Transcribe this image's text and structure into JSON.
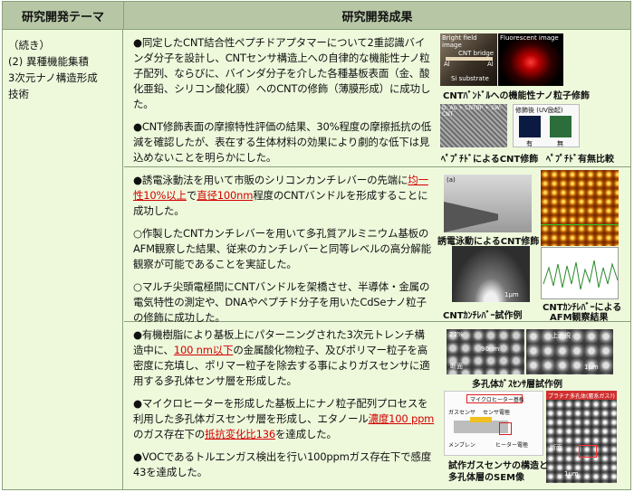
{
  "headers": {
    "left": "研究開発テーマ",
    "right": "研究開発成果"
  },
  "theme": {
    "line1": "（続き）",
    "line2": "(2) 異種機能集積",
    "line3": "3次元ナノ構造形成",
    "line4": "技術"
  },
  "section1": {
    "p1": "●同定したCNT結合性ペプチドアプタマーについて2重認識バインダ分子を設計し、CNTセンサ構造上への自律的な機能性ナノ粒子配列、ならびに、バインダ分子を介した各種基板表面（金、酸化亜鉛、シリコン酸化膜）へのCNTの修飾（薄膜形成）に成功した。",
    "p2": "●CNT修飾表面の摩擦特性評価の結果、30%程度の摩擦抵抗の低減を確認したが、表在する生体材料の効果により劇的な低下は見込めないことを明らかにした。",
    "img_bright": "Bright field image",
    "img_fluor": "Fluorescent image",
    "img_cnt_bridge": "CNT bridge",
    "img_al": "Al",
    "img_si": "Si substrate",
    "img_sem_label": "D: Au + CNTBP + SW-CNT",
    "img_mod_label": "修飾後 (UV励起)",
    "img_yes": "有",
    "img_no": "無",
    "cap1": "CNTﾊﾞﾝﾄﾞﾙへの機能性ナノ粒子修飾",
    "cap2": "ﾍﾟﾌﾟﾁﾄﾞによるCNT修飾",
    "cap3": "ﾍﾟﾌﾟﾁﾄﾞ有無比較"
  },
  "section2": {
    "p1a": "●誘電泳動法を用いて市販のシリコンカンチレバーの先端に",
    "p1r1": "均一性10%以上",
    "p1b": "で",
    "p1r2": "直径100nm",
    "p1c": "程度のCNTバンドルを形成することに成功した。",
    "p2": "○作製したCNTカンチレバーを用いて多孔質アルミニウム基板のAFM観察した結果、従来のカンチレバーと同等レベルの高分解能観察が可能であることを実証した。",
    "p3": "○マルチ尖頭電極間にCNTバンドルを架橋させ、半導体・金属の電気特性の測定や、DNAやペプチド分子を用いたCdSeナノ粒子の修飾に成功した。",
    "img_a": "(a)",
    "img_scale": "1μm",
    "cap1": "誘電泳動によるCNT修飾",
    "cap2": "CNTｶﾝﾁﾚﾊﾞｰ試作例",
    "cap3a": "CNTｶﾝﾁﾚﾊﾞｰによる",
    "cap3b": "AFM観察結果"
  },
  "section3": {
    "p1a": "●有機樹脂により基板上にパターニングされた3次元トレンチ構造中に、",
    "p1r": "100 nm以下",
    "p1b": "の金属酸化物粒子、及びポリマー粒子を高密度に充填し、ポリマー粒子を除去する事によりガスセンサに適用する多孔体センサ層を形成した。",
    "p2a": "●マイクロヒーターを形成した基板上にナノ粒子配列プロセスを利用した多孔体ガスセンサ層を形成し、エタノール",
    "p2r1": "濃度100 ppm",
    "p2b": "のガス存在下の",
    "p2r2": "抵抗変化比136",
    "p2c": "を達成した。",
    "p3": "●VOCであるトルエンガス検出を行い100ppmガス存在下で感度43を達成した。",
    "img_22": "22%",
    "img_top": "上面視",
    "img_section": "断面",
    "img_90nm": "90nm",
    "img_1um": "1μm",
    "img_heater": "マイクロヒーター基板",
    "img_gas": "ガスセンサ",
    "img_sensor": "センサ電極",
    "img_membrane": "メンブレン",
    "img_heater_el": "ヒーター電極",
    "img_porous": "プラチナ多孔体(層系ガス?)",
    "cap1": "多孔体ｶﾞｽｾﾝｻ層試作例",
    "cap2a": "試作ガスセンサの構造と",
    "cap2b": "多孔体層のSEM像"
  }
}
